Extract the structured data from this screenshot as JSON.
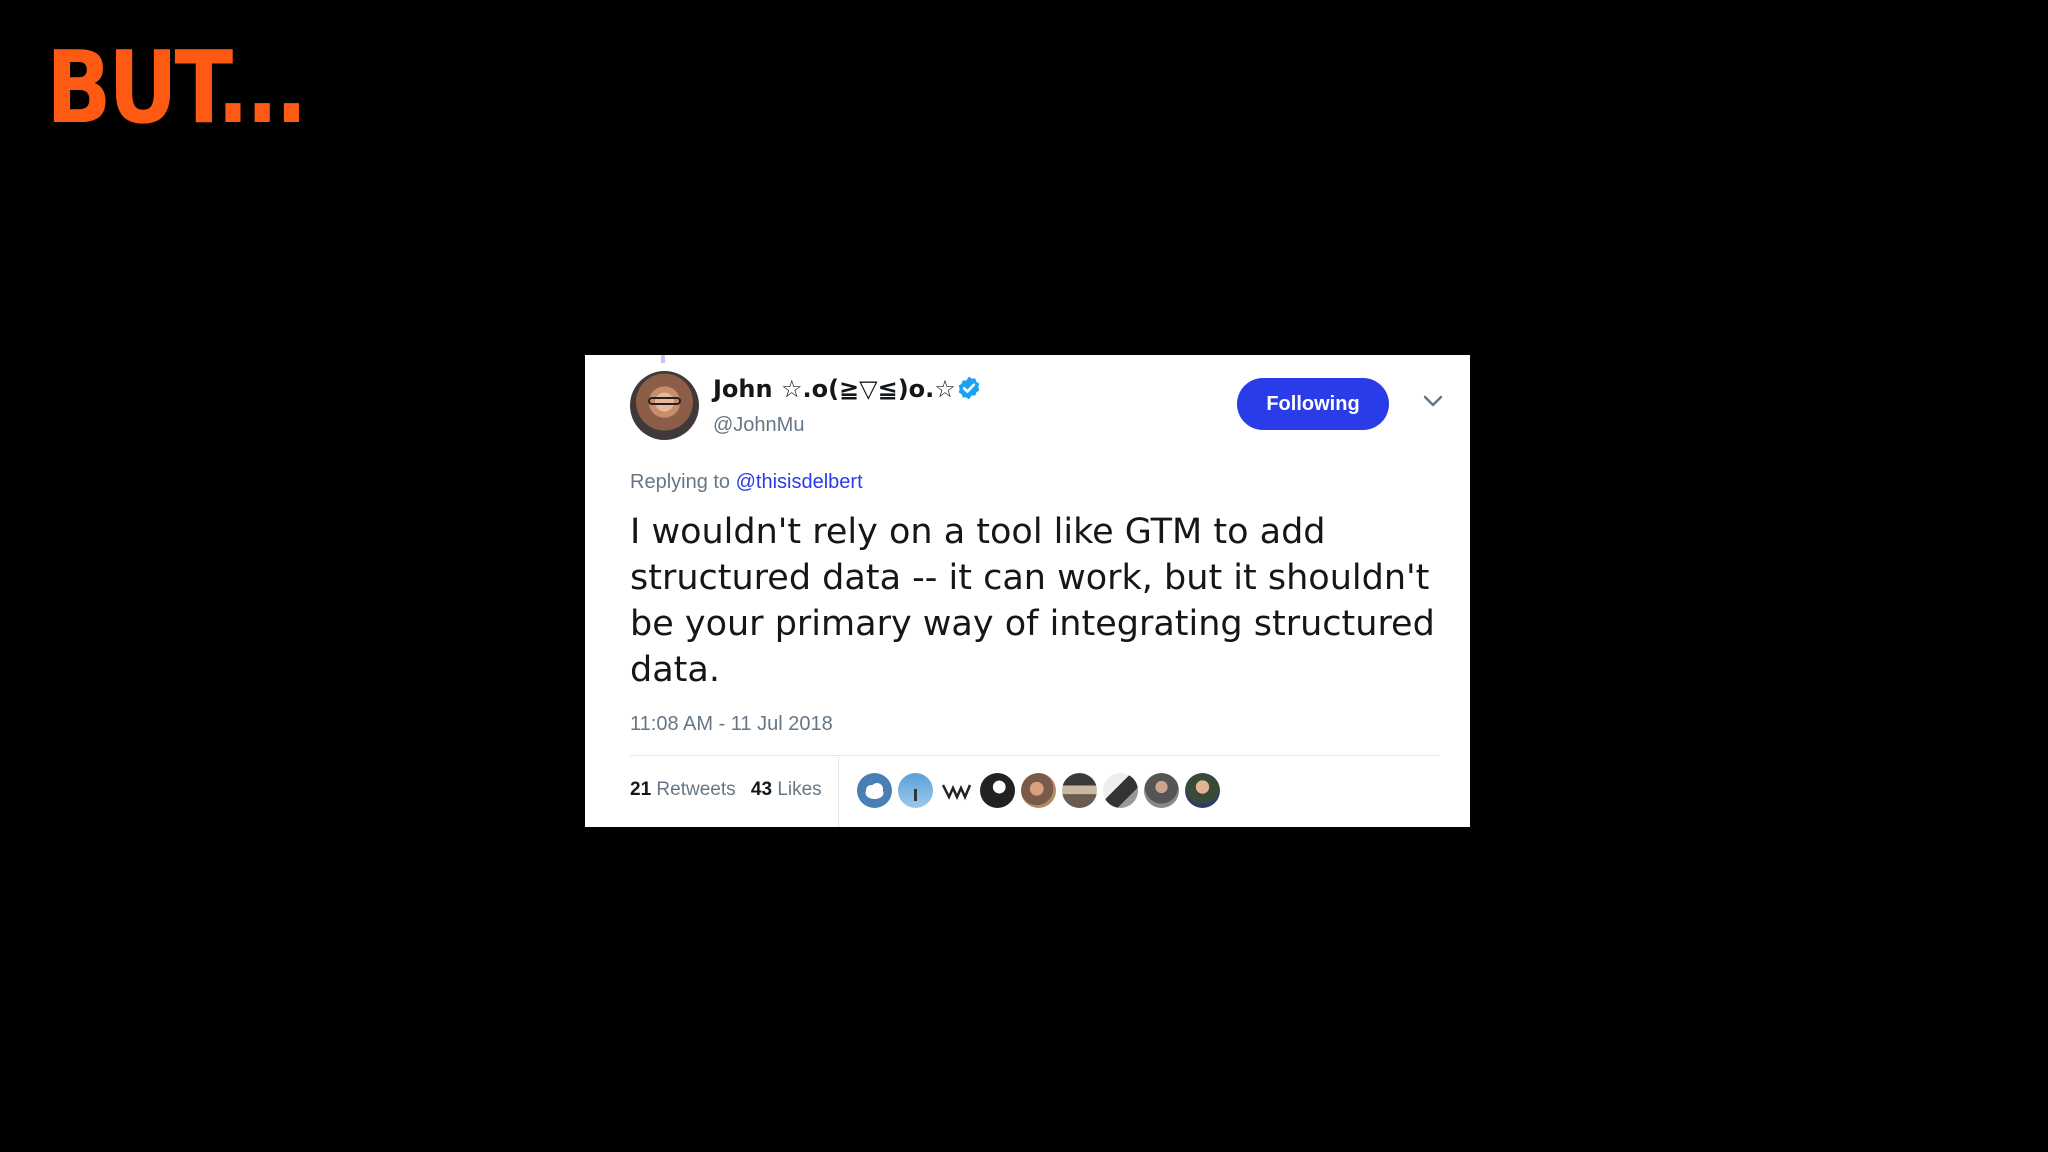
{
  "slide": {
    "title": "BUT..."
  },
  "tweet": {
    "display_name": "John ☆.o(≧▽≦)o.☆",
    "handle": "@JohnMu",
    "follow_label": "Following",
    "replying_prefix": "Replying to",
    "replying_to": "@thisisdelbert",
    "text": "I wouldn't rely on a tool like GTM to add structured data -- it can work, but it shouldn't be your primary way of integrating structured data.",
    "timestamp": "11:08 AM - 11 Jul 2018",
    "retweets_count": "21",
    "retweets_label": "Retweets",
    "likes_count": "43",
    "likes_label": "Likes",
    "liker_avatars": 9
  },
  "colors": {
    "title_orange": "#ff5a14",
    "follow_blue": "#2a3ce8",
    "verified_blue": "#1da1f2",
    "secondary_gray": "#657786"
  },
  "icons": [
    "verified-badge-icon",
    "chevron-down-icon"
  ]
}
